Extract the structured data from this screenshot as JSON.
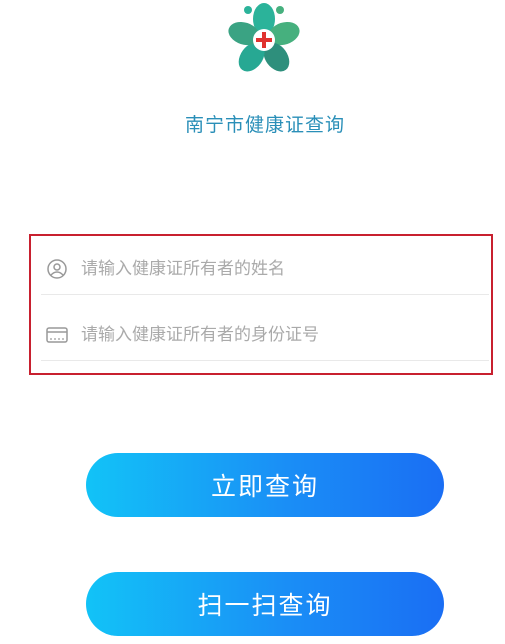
{
  "header": {
    "title": "南宁市健康证查询",
    "logo_icon": "flower-medical-cross-logo"
  },
  "form": {
    "name_field": {
      "placeholder": "请输入健康证所有者的姓名",
      "value": "",
      "icon": "user-icon"
    },
    "id_field": {
      "placeholder": "请输入健康证所有者的身份证号",
      "value": "",
      "icon": "id-card-icon"
    }
  },
  "actions": {
    "query_label": "立即查询",
    "scan_label": "扫一扫查询"
  },
  "colors": {
    "accent": "#1a8ff6",
    "highlight_border": "#c8202f",
    "title": "#2a8fb8"
  }
}
